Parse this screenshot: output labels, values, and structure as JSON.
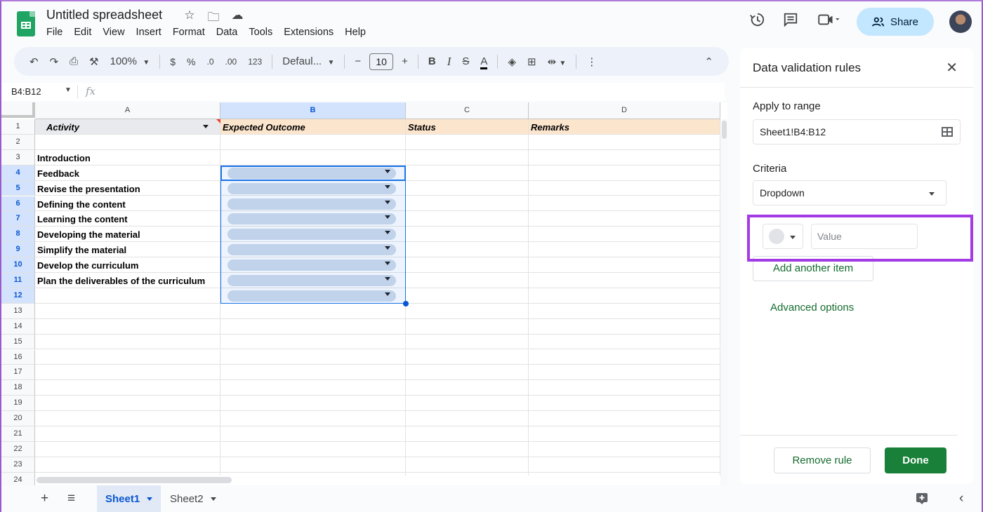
{
  "header": {
    "doc_title": "Untitled spreadsheet",
    "title_icons": [
      "star-icon",
      "move-to-folder-icon",
      "cloud-saved-icon"
    ],
    "menu": [
      "File",
      "Edit",
      "View",
      "Insert",
      "Format",
      "Data",
      "Tools",
      "Extensions",
      "Help"
    ],
    "right_icons": [
      "version-history-icon",
      "comments-icon",
      "meet-icon"
    ],
    "share_label": "Share"
  },
  "toolbar": {
    "zoom": "100%",
    "currency": "$",
    "percent": "%",
    "decrease_decimal": ".0",
    "increase_decimal": ".00",
    "number_format": "123",
    "font": "Defaul...",
    "font_size": "10",
    "bold": "B",
    "italic": "I",
    "strike": "S",
    "text_color": "A"
  },
  "formula_bar": {
    "name_box": "B4:B12",
    "fx": "fx",
    "value": ""
  },
  "grid": {
    "columns": [
      "A",
      "B",
      "C",
      "D"
    ],
    "selected_column": "B",
    "rows": [
      {
        "n": "1",
        "a": "Activity",
        "b": "Expected Outcome",
        "c": "Status",
        "d": "Remarks",
        "header": true
      },
      {
        "n": "2",
        "a": "",
        "b": "",
        "c": "",
        "d": ""
      },
      {
        "n": "3",
        "a": "Introduction",
        "b": "",
        "c": "",
        "d": ""
      },
      {
        "n": "4",
        "a": "Feedback",
        "b": "",
        "c": "",
        "d": "",
        "dropdown": true
      },
      {
        "n": "5",
        "a": "Revise the presentation",
        "b": "",
        "c": "",
        "d": "",
        "dropdown": true
      },
      {
        "n": "6",
        "a": "Defining the content",
        "b": "",
        "c": "",
        "d": "",
        "dropdown": true
      },
      {
        "n": "7",
        "a": "Learning the content",
        "b": "",
        "c": "",
        "d": "",
        "dropdown": true
      },
      {
        "n": "8",
        "a": "Developing the material",
        "b": "",
        "c": "",
        "d": "",
        "dropdown": true
      },
      {
        "n": "9",
        "a": "Simplify the material",
        "b": "",
        "c": "",
        "d": "",
        "dropdown": true
      },
      {
        "n": "10",
        "a": "Develop the curriculum",
        "b": "",
        "c": "",
        "d": "",
        "dropdown": true
      },
      {
        "n": "11",
        "a": "Plan the deliverables of the curriculum",
        "b": "",
        "c": "",
        "d": "",
        "dropdown": true
      },
      {
        "n": "12",
        "a": "",
        "b": "",
        "c": "",
        "d": "",
        "dropdown": true
      },
      {
        "n": "13"
      },
      {
        "n": "14"
      },
      {
        "n": "15"
      },
      {
        "n": "16"
      },
      {
        "n": "17"
      },
      {
        "n": "18"
      },
      {
        "n": "19"
      },
      {
        "n": "20"
      },
      {
        "n": "21"
      },
      {
        "n": "22"
      },
      {
        "n": "23"
      },
      {
        "n": "24"
      }
    ],
    "colors": {
      "header_fill": "#fce5cd",
      "selection": "#1a73e8",
      "dropdown_chip": "#d0dbec"
    }
  },
  "sheets": {
    "tabs": [
      {
        "label": "Sheet1",
        "active": true
      },
      {
        "label": "Sheet2",
        "active": false
      }
    ]
  },
  "panel": {
    "title": "Data validation rules",
    "apply_to_range_label": "Apply to range",
    "range_value": "Sheet1!B4:B12",
    "criteria_label": "Criteria",
    "criteria_value": "Dropdown",
    "item_value_placeholder": "Value",
    "item_value": "",
    "add_item_label": "Add another item",
    "advanced_label": "Advanced options",
    "remove_label": "Remove rule",
    "done_label": "Done",
    "accent_color": "#188038",
    "highlight_color": "#a23be4"
  }
}
